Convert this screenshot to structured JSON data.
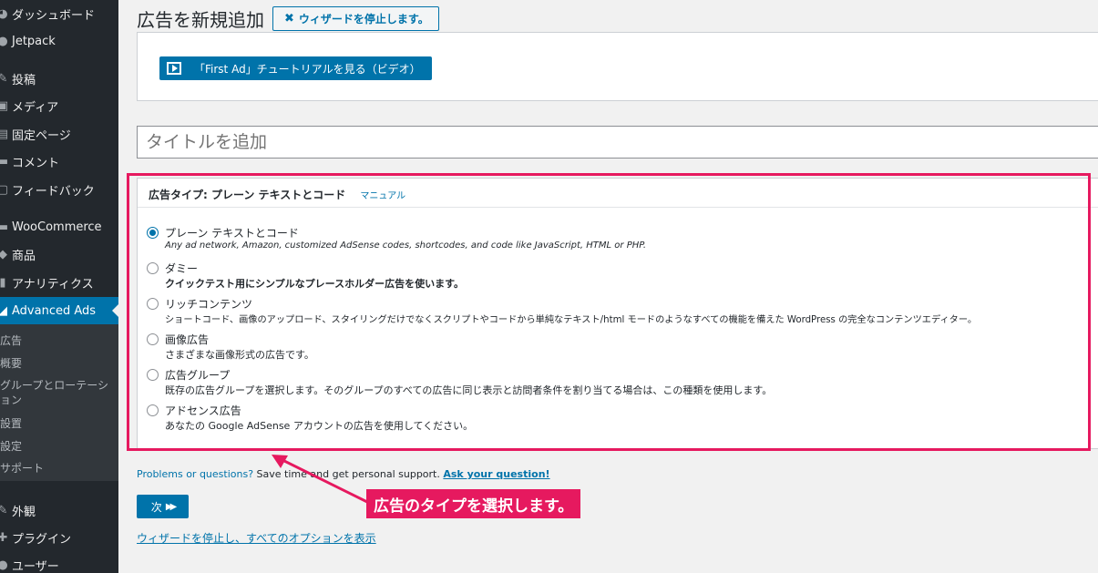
{
  "sidebar": {
    "items": [
      {
        "label": "ダッシュボード",
        "icon": "dashboard-icon",
        "glyph": "◕"
      },
      {
        "label": "Jetpack",
        "icon": "jetpack-icon",
        "glyph": "●"
      },
      {
        "label": "投稿",
        "icon": "pin-icon",
        "glyph": "✎"
      },
      {
        "label": "メディア",
        "icon": "media-icon",
        "glyph": "▣"
      },
      {
        "label": "固定ページ",
        "icon": "page-icon",
        "glyph": "▤"
      },
      {
        "label": "コメント",
        "icon": "comment-icon",
        "glyph": "▬"
      },
      {
        "label": "フィードバック",
        "icon": "feedback-icon",
        "glyph": "▢"
      },
      {
        "label": "WooCommerce",
        "icon": "woocommerce-icon",
        "glyph": "▬"
      },
      {
        "label": "商品",
        "icon": "products-icon",
        "glyph": "◆"
      },
      {
        "label": "アナリティクス",
        "icon": "analytics-icon",
        "glyph": "▮"
      },
      {
        "label": "Advanced Ads",
        "icon": "advanced-ads-icon",
        "glyph": "◢"
      },
      {
        "label": "外観",
        "icon": "appearance-icon",
        "glyph": "✎"
      },
      {
        "label": "プラグイン",
        "icon": "plugin-icon",
        "glyph": "✚"
      },
      {
        "label": "ユーザー",
        "icon": "user-icon",
        "glyph": "●"
      }
    ],
    "submenu": [
      "広告",
      "概要",
      "グループとローテーシ",
      "ョン",
      "設置",
      "設定",
      "サポート"
    ]
  },
  "header": {
    "title": "広告を新規追加",
    "stop_wizard_label": "ウィザードを停止します。"
  },
  "tutorial": {
    "button_label": "「First Ad」チュートリアルを見る（ビデオ）"
  },
  "title_input": {
    "placeholder": "タイトルを追加"
  },
  "ad_type_box": {
    "heading": "広告タイプ: プレーン テキストとコード",
    "manual_link": "マニュアル",
    "options": [
      {
        "label": "プレーン テキストとコード",
        "desc": "Any ad network, Amazon, customized AdSense codes, shortcodes, and code like JavaScript, HTML or PHP.",
        "checked": true
      },
      {
        "label": "ダミー",
        "desc": "クイックテスト用にシンプルなプレースホルダー広告を使います。",
        "checked": false
      },
      {
        "label": "リッチコンテンツ",
        "desc": "ショートコード、画像のアップロード、スタイリングだけでなくスクリプトやコードから単純なテキスト/html モードのようなすべての機能を備えた WordPress の完全なコンテンツエディター。",
        "checked": false
      },
      {
        "label": "画像広告",
        "desc": "さまざまな画像形式の広告です。",
        "checked": false
      },
      {
        "label": "広告グループ",
        "desc": "既存の広告グループを選択します。そのグループのすべての広告に同じ表示と訪問者条件を割り当てる場合は、この種類を使用します。",
        "checked": false
      },
      {
        "label": "アドセンス広告",
        "desc": "あなたの Google AdSense アカウントの広告を使用してください。",
        "checked": false
      }
    ]
  },
  "support": {
    "question": "Problems or questions?",
    "text": " Save time and get personal support. ",
    "link": "Ask your question!"
  },
  "next_button": {
    "label": "次",
    "arrow": "▶▶"
  },
  "stop_link": "ウィザードを停止し、すべてのオプションを表示",
  "annotation": {
    "callout": "広告のタイプを選択します。",
    "color": "#e6195f"
  },
  "colors": {
    "accent": "#0073aa",
    "sidebar": "#23282d",
    "highlight": "#e6195f"
  }
}
